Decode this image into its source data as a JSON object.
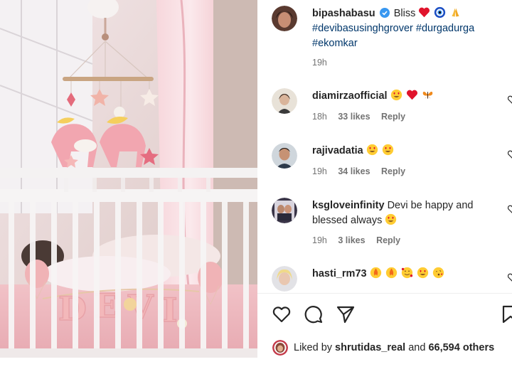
{
  "post": {
    "author": "bipashabasu",
    "caption_text": "Bliss",
    "hashtags_line1": "#devibasusinghgrover #durgadurga",
    "hashtags_line2": "#ekomkar",
    "time": "19h"
  },
  "comments": [
    {
      "user": "diamirzaofficial",
      "text": "",
      "time": "18h",
      "likes": "33 likes",
      "reply": "Reply"
    },
    {
      "user": "rajivadatia",
      "text": "",
      "time": "19h",
      "likes": "34 likes",
      "reply": "Reply"
    },
    {
      "user": "ksgloveinfinity",
      "text": "Devi be happy and",
      "text2": "blessed always",
      "time": "19h",
      "likes": "3 likes",
      "reply": "Reply"
    },
    {
      "user": "hasti_rm73",
      "text": ""
    }
  ],
  "liked_by": {
    "prefix": "Liked by",
    "user": "shrutidas_real",
    "and": "and",
    "count": "66,594 others"
  },
  "photo": {
    "banner_letters": [
      "D",
      "E",
      "V",
      "I"
    ]
  },
  "colors": {
    "hashtag": "#00376b",
    "heart": "#ed4956",
    "meta": "#737373"
  }
}
